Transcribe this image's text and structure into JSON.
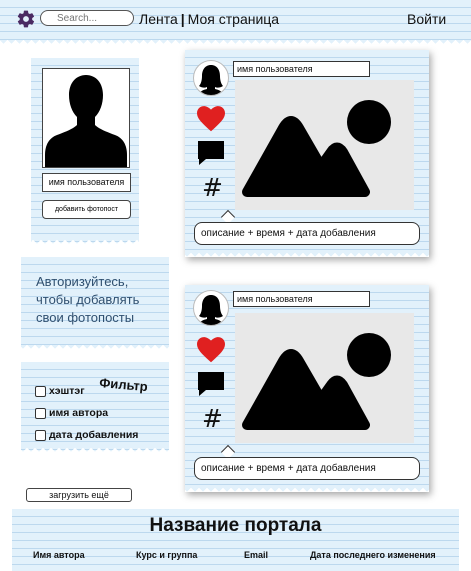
{
  "header": {
    "search_placeholder": "Search...",
    "nav_feed": "Лента",
    "nav_separator": "|",
    "nav_my_page": "Моя страница",
    "login": "Войти"
  },
  "profile": {
    "username": "имя пользователя",
    "add_post": "добавить фотопост"
  },
  "auth_note": "Авторизуйтесь, чтобы добавлять свои фотопосты",
  "filter": {
    "title": "Фильтр",
    "options": [
      {
        "label": "хэштэг",
        "checked": false
      },
      {
        "label": "имя автора",
        "checked": false
      },
      {
        "label": "дата добавления",
        "checked": false
      }
    ]
  },
  "load_more": "загрузить ещё",
  "posts": [
    {
      "username": "имя пользователя",
      "caption": "описание + время + дата добавления",
      "hashtag_icon": "#"
    },
    {
      "username": "имя пользователя",
      "caption": "описание + время + дата добавления",
      "hashtag_icon": "#"
    }
  ],
  "footer": {
    "title": "Название портала",
    "columns": [
      "Имя автора",
      "Курс и группа",
      "Email",
      "Дата последнего изменения"
    ]
  },
  "colors": {
    "paper": "#e2f1fb",
    "paper_lines": "#bcd8ee",
    "settings_icon": "#4a2a62",
    "heart": "#e02020"
  },
  "icons": [
    "settings-icon",
    "user-silhouette-icon",
    "heart-icon",
    "comment-icon",
    "hashtag-icon",
    "image-placeholder-icon"
  ]
}
